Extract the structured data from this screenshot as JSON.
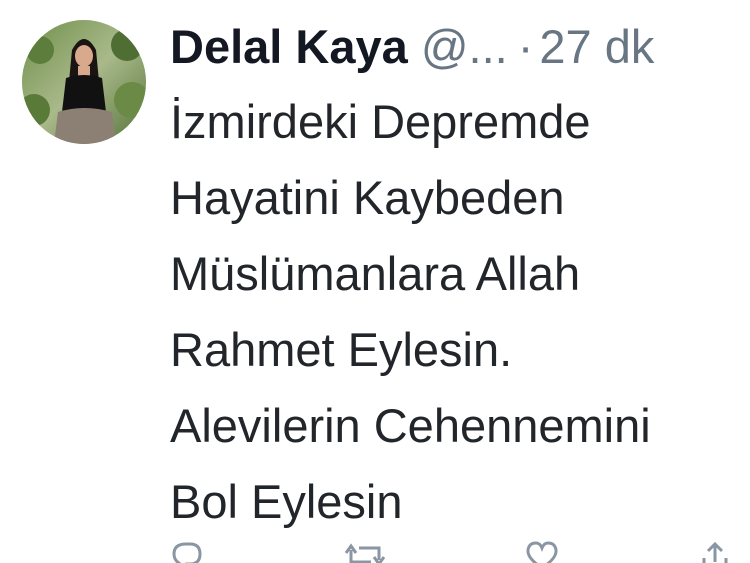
{
  "tweet": {
    "author_name": "Delal Kaya",
    "handle": "@...",
    "separator": "·",
    "time": "27 dk",
    "text_lines": [
      "İzmirdeki Depremde",
      "Hayatini Kaybeden",
      "Müslümanlara Allah",
      "Rahmet Eylesin.",
      "Alevilerin Cehennemini",
      "Bol Eylesin"
    ]
  },
  "actions": {
    "icons": [
      "reply-icon",
      "retweet-icon",
      "like-icon",
      "share-icon"
    ]
  }
}
